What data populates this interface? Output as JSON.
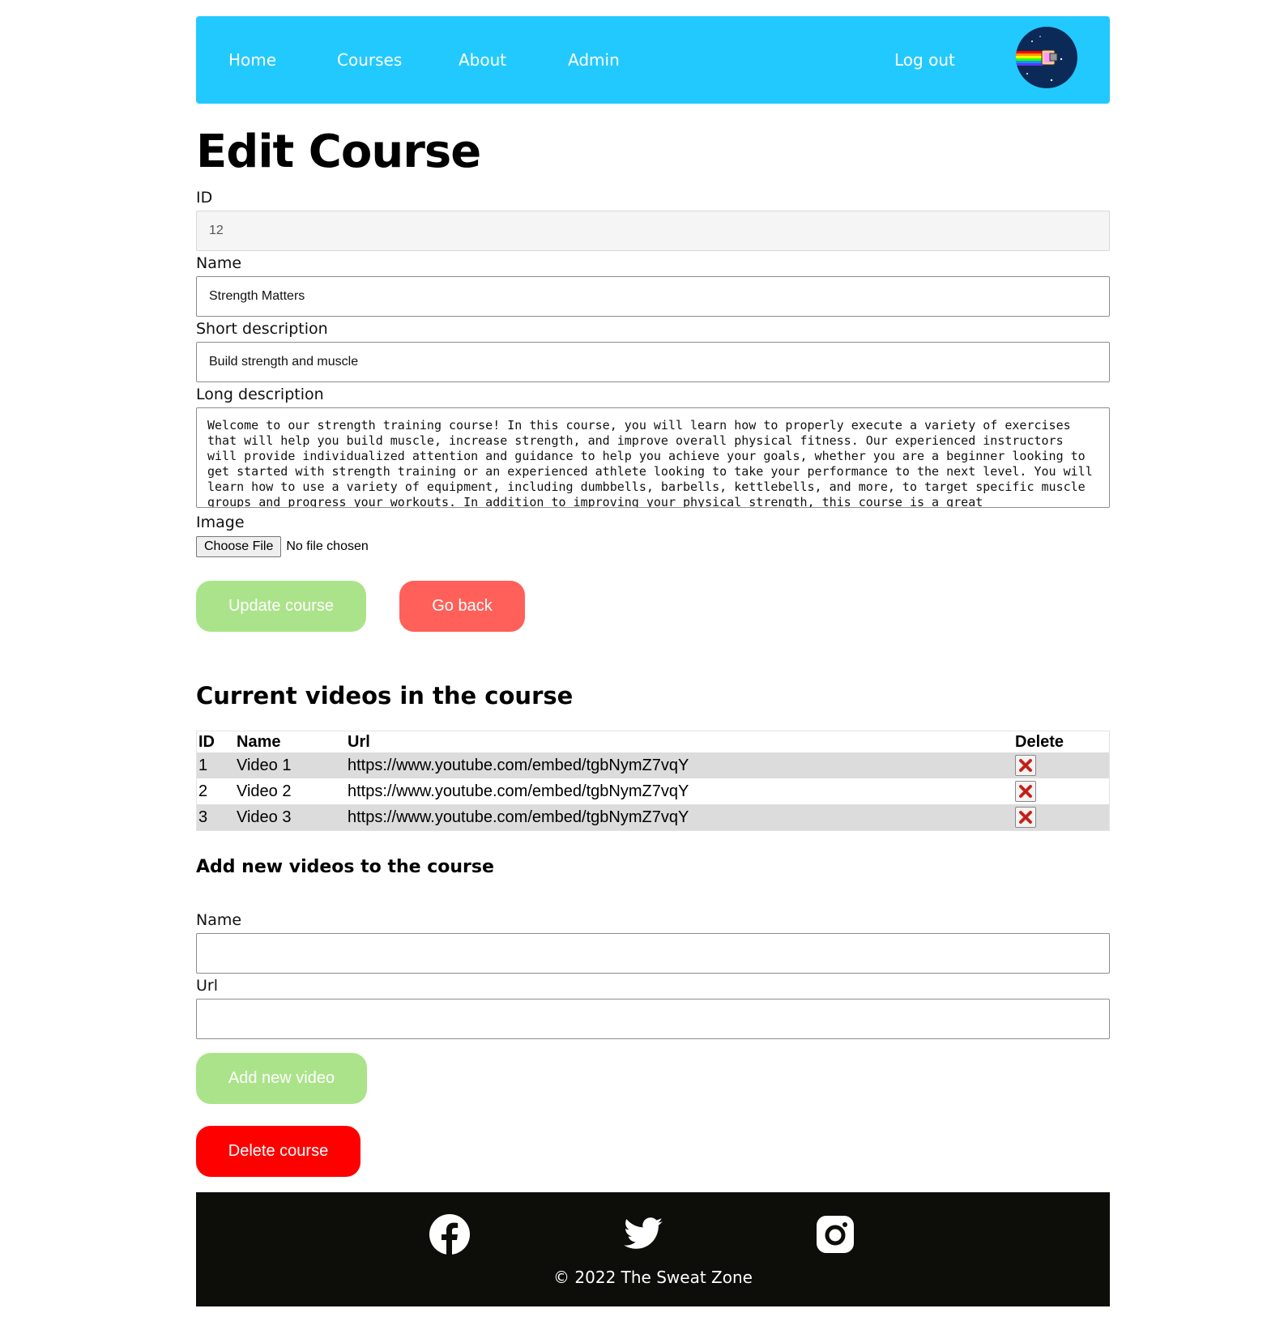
{
  "nav": {
    "links": [
      "Home",
      "Courses",
      "About",
      "Admin"
    ],
    "logout": "Log out",
    "avatar_icon": "nyan-cat-avatar"
  },
  "page": {
    "title": "Edit Course"
  },
  "form": {
    "id_label": "ID",
    "id_value": "12",
    "name_label": "Name",
    "name_value": "Strength Matters",
    "short_label": "Short description",
    "short_value": "Build strength and muscle",
    "long_label": "Long description",
    "long_value": "Welcome to our strength training course! In this course, you will learn how to properly execute a variety of exercises that will help you build muscle, increase strength, and improve overall physical fitness. Our experienced instructors will provide individualized attention and guidance to help you achieve your goals, whether you are a beginner looking to get started with strength training or an experienced athlete looking to take your performance to the next level. You will learn how to use a variety of equipment, including dumbbells, barbells, kettlebells, and more, to target specific muscle groups and progress your workouts. In addition to improving your physical strength, this course is a great",
    "image_label": "Image",
    "file_button": "Choose File",
    "file_status": "No file chosen",
    "update_button": "Update course",
    "back_button": "Go back"
  },
  "videos": {
    "heading": "Current videos in the course",
    "columns": [
      "ID",
      "Name",
      "Url",
      "Delete"
    ],
    "rows": [
      {
        "id": "1",
        "name": "Video 1",
        "url": "https://www.youtube.com/embed/tgbNymZ7vqY"
      },
      {
        "id": "2",
        "name": "Video 2",
        "url": "https://www.youtube.com/embed/tgbNymZ7vqY"
      },
      {
        "id": "3",
        "name": "Video 3",
        "url": "https://www.youtube.com/embed/tgbNymZ7vqY"
      }
    ],
    "delete_icon": "red-x-icon"
  },
  "add_video": {
    "heading": "Add new videos to the course",
    "name_label": "Name",
    "name_value": "",
    "url_label": "Url",
    "url_value": "",
    "add_button": "Add new video"
  },
  "delete_course_button": "Delete course",
  "footer": {
    "icons": [
      "facebook-icon",
      "twitter-icon",
      "instagram-icon"
    ],
    "copyright": "© 2022 The Sweat Zone"
  },
  "colors": {
    "navbar": "#22c9ff",
    "update_button": "#abe38a",
    "back_button": "#ff6059",
    "delete_course_button": "#ff0000",
    "footer": "#0d0e0a"
  }
}
